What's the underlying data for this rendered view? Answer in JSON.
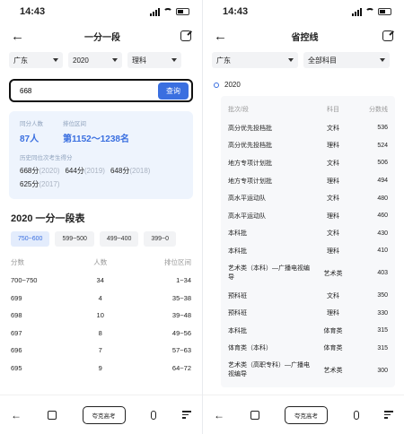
{
  "left": {
    "status_time": "14:43",
    "title": "一分一段",
    "filters": [
      "广东",
      "2020",
      "理科"
    ],
    "search": {
      "value": "668",
      "button": "查询"
    },
    "result": {
      "count_label": "同分人数",
      "count_value": "87人",
      "range_label": "排位区间",
      "range_value": "第1152～1238名",
      "history_label": "历史同位次考生得分",
      "history": [
        {
          "score": "668分",
          "year": "(2020)"
        },
        {
          "score": "644分",
          "year": "(2019)"
        },
        {
          "score": "648分",
          "year": "(2018)"
        },
        {
          "score": "625分",
          "year": "(2017)"
        }
      ]
    },
    "section_title": "2020 一分一段表",
    "chips": [
      "750~600",
      "599~500",
      "499~400",
      "399~0"
    ],
    "table": {
      "headers": [
        "分数",
        "人数",
        "排位区间"
      ],
      "rows": [
        [
          "700~750",
          "34",
          "1~34"
        ],
        [
          "699",
          "4",
          "35~38"
        ],
        [
          "698",
          "10",
          "39~48"
        ],
        [
          "697",
          "8",
          "49~56"
        ],
        [
          "696",
          "7",
          "57~63"
        ],
        [
          "695",
          "9",
          "64~72"
        ]
      ]
    },
    "bottom_pill": "夸克高考"
  },
  "right": {
    "status_time": "14:43",
    "title": "省控线",
    "filters": [
      "广东",
      "全部科目"
    ],
    "year": "2020",
    "table": {
      "headers": [
        "批次/段",
        "科目",
        "分数线"
      ],
      "rows": [
        [
          "高分优先投档批",
          "文科",
          "536"
        ],
        [
          "高分优先投档批",
          "理科",
          "524"
        ],
        [
          "地方专项计划批",
          "文科",
          "506"
        ],
        [
          "地方专项计划批",
          "理科",
          "494"
        ],
        [
          "高水平运动队",
          "文科",
          "480"
        ],
        [
          "高水平运动队",
          "理科",
          "460"
        ],
        [
          "本科批",
          "文科",
          "430"
        ],
        [
          "本科批",
          "理科",
          "410"
        ],
        [
          "艺术类（本科）—广播电视编导",
          "艺术类",
          "403"
        ],
        [
          "预科班",
          "文科",
          "350"
        ],
        [
          "预科班",
          "理科",
          "330"
        ],
        [
          "本科批",
          "体育类",
          "315"
        ],
        [
          "体育类（本科）",
          "体育类",
          "315"
        ],
        [
          "艺术类（高职专科）—广播电视编导",
          "艺术类",
          "300"
        ]
      ]
    },
    "bottom_pill": "夸克高考"
  },
  "colors": {
    "accent": "#3a6fe0",
    "result_bg": "#eef4fd"
  }
}
